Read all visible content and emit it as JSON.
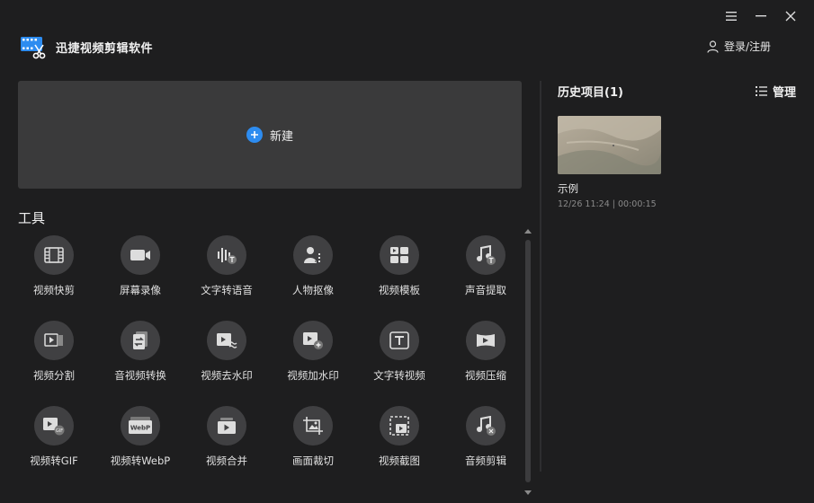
{
  "app": {
    "title": "迅捷视频剪辑软件"
  },
  "header": {
    "login_label": "登录/注册"
  },
  "new_project": {
    "label": "新建"
  },
  "tools": {
    "title": "工具",
    "items": [
      {
        "label": "视频快剪",
        "icon": "film-icon"
      },
      {
        "label": "屏幕录像",
        "icon": "camera-icon"
      },
      {
        "label": "文字转语音",
        "icon": "text-to-speech-icon"
      },
      {
        "label": "人物抠像",
        "icon": "person-cutout-icon"
      },
      {
        "label": "视频模板",
        "icon": "template-icon"
      },
      {
        "label": "声音提取",
        "icon": "audio-extract-icon"
      },
      {
        "label": "视频分割",
        "icon": "split-icon"
      },
      {
        "label": "音视频转换",
        "icon": "convert-icon"
      },
      {
        "label": "视频去水印",
        "icon": "remove-watermark-icon"
      },
      {
        "label": "视频加水印",
        "icon": "add-watermark-icon"
      },
      {
        "label": "文字转视频",
        "icon": "text-to-video-icon"
      },
      {
        "label": "视频压缩",
        "icon": "compress-icon"
      },
      {
        "label": "视频转GIF",
        "icon": "gif-icon"
      },
      {
        "label": "视频转WebP",
        "icon": "webp-icon"
      },
      {
        "label": "视频合并",
        "icon": "merge-icon"
      },
      {
        "label": "画面裁切",
        "icon": "crop-icon"
      },
      {
        "label": "视频截图",
        "icon": "screenshot-icon"
      },
      {
        "label": "音频剪辑",
        "icon": "audio-cut-icon"
      }
    ]
  },
  "history": {
    "title": "历史项目(1)",
    "manage_label": "管理",
    "projects": [
      {
        "name": "示例",
        "meta": "12/26 11:24 | 00:00:15"
      }
    ]
  },
  "colors": {
    "background": "#1e1e1f",
    "panel": "#3a3a3b",
    "accent": "#2d8cf0",
    "icon_bg": "#404042"
  }
}
